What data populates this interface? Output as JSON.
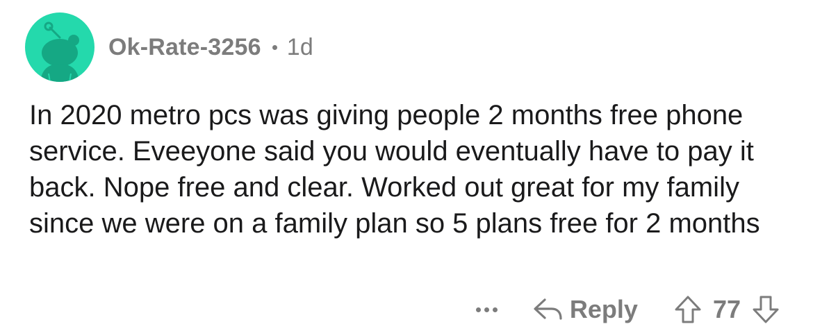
{
  "comment": {
    "username": "Ok-Rate-3256",
    "age": "1d",
    "text": "In 2020 metro pcs was giving people 2 months free phone service. Eveeyone said you would eventually have to pay it back. Nope free and clear. Worked out great for my family since we were on a family plan so 5 plans free for 2 months",
    "reply_label": "Reply",
    "score": "77",
    "avatar_color": "#24d9ac"
  },
  "icons": {
    "avatar": "snoo-avatar-icon",
    "more": "more-options-icon",
    "reply": "reply-arrow-icon",
    "upvote": "upvote-arrow-icon",
    "downvote": "downvote-arrow-icon"
  }
}
